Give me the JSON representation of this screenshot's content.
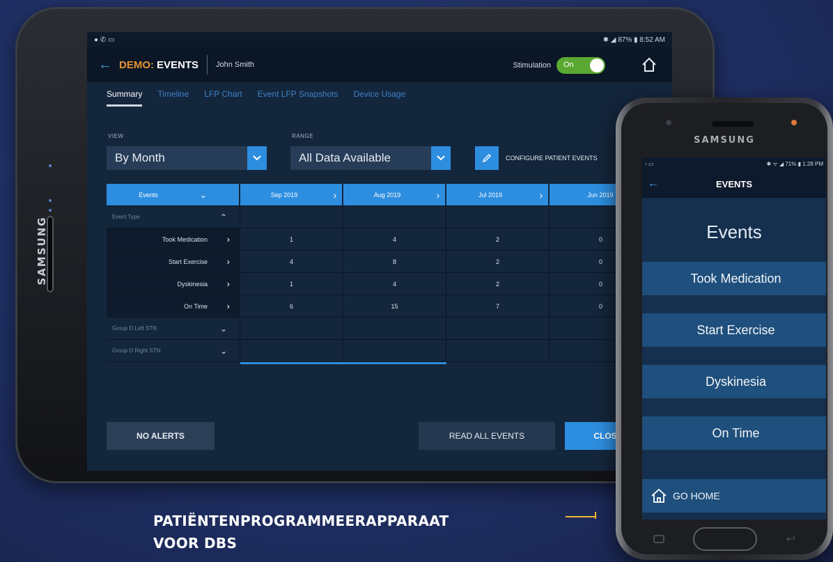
{
  "tablet": {
    "brand": "SAMSUNG",
    "status_bar": {
      "right": "✱ ◢ 87% ▮ 8:52 AM"
    },
    "app_bar": {
      "title_demo": "DEMO:",
      "title_events": "EVENTS",
      "patient": "John Smith",
      "stimulation_label": "Stimulation",
      "stimulation_state": "On"
    },
    "tabs": [
      "Summary",
      "Timeline",
      "LFP Chart",
      "Event LFP Snapshots",
      "Device Usage"
    ],
    "view": {
      "label": "VIEW",
      "value": "By Month"
    },
    "range": {
      "label": "RANGE",
      "value": "All Data Available"
    },
    "configure_label": "CONFIGURE PATIENT EVENTS",
    "grid": {
      "header_left": "Events",
      "months": [
        "Sep 2019",
        "Aug 2019",
        "Jul 2019",
        "Jun 2019"
      ],
      "event_type_label": "Event Type",
      "rows": [
        {
          "label": "Took Medication",
          "values": [
            "1",
            "4",
            "2",
            "0"
          ]
        },
        {
          "label": "Start Exercise",
          "values": [
            "4",
            "8",
            "2",
            "0"
          ]
        },
        {
          "label": "Dyskinesia",
          "values": [
            "1",
            "4",
            "2",
            "0"
          ]
        },
        {
          "label": "On Time",
          "values": [
            "6",
            "15",
            "7",
            "0"
          ]
        }
      ],
      "groups": [
        "Group D Left STN",
        "Group D Right STN"
      ]
    },
    "buttons": {
      "alerts": "NO ALERTS",
      "read_all": "READ ALL EVENTS",
      "close": "CLOSE"
    }
  },
  "phone": {
    "brand": "SAMSUNG",
    "status_bar": {
      "right": "✱ ᯤ ◢ 71% ▮ 1:28 PM"
    },
    "app_title": "EVENTS",
    "heading": "Events",
    "buttons": [
      "Took Medication",
      "Start Exercise",
      "Dyskinesia",
      "On Time"
    ],
    "home": "GO HOME"
  },
  "caption": {
    "line1": "PATIËNTENPROGRAMMEERAPPARAAT",
    "line2": "VOOR DBS"
  },
  "colors": {
    "accent_blue": "#2d8ee0",
    "toggle_green": "#5aa832",
    "demo_orange": "#e69332",
    "caption_gold": "#f0b82e"
  }
}
